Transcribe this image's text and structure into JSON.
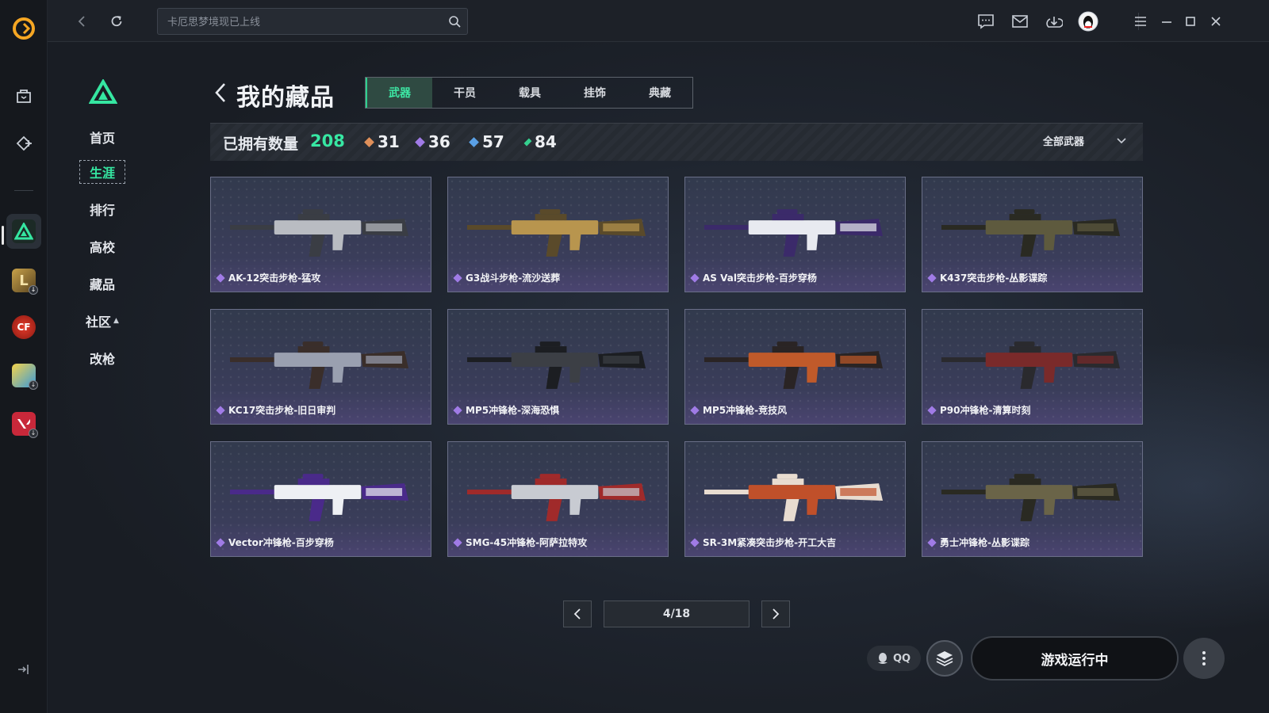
{
  "topbar": {
    "search_placeholder": "卡厄思梦境现已上线"
  },
  "side_nav": {
    "items": [
      {
        "label": "首页"
      },
      {
        "label": "生涯"
      },
      {
        "label": "排行"
      },
      {
        "label": "高校"
      },
      {
        "label": "藏品"
      },
      {
        "label": "社区"
      },
      {
        "label": "改枪"
      }
    ],
    "active_index": 1
  },
  "header": {
    "title": "我的藏品",
    "tabs": [
      "武器",
      "干员",
      "载具",
      "挂饰",
      "典藏"
    ],
    "active_tab": 0
  },
  "stats": {
    "owned_label": "已拥有数量",
    "owned_total": "208",
    "counts": [
      {
        "value": "31",
        "color": "#e0905a"
      },
      {
        "value": "36",
        "color": "#a07be6"
      },
      {
        "value": "57",
        "color": "#5aa0e6"
      },
      {
        "value": "84",
        "color": "#35d08f"
      }
    ],
    "filter_label": "全部武器"
  },
  "items": [
    {
      "name": "AK-12突击步枪-猛攻",
      "rarity_color": "#a07be6",
      "palette": [
        "#b9bcc2",
        "#3a3d44"
      ]
    },
    {
      "name": "G3战斗步枪-流沙送葬",
      "rarity_color": "#a07be6",
      "palette": [
        "#b8954e",
        "#5a4a2a"
      ]
    },
    {
      "name": "AS Val突击步枪-百步穿杨",
      "rarity_color": "#a07be6",
      "palette": [
        "#e8eaf0",
        "#3b2a6a"
      ]
    },
    {
      "name": "K437突击步枪-丛影谍踪",
      "rarity_color": "#a07be6",
      "palette": [
        "#5e5a3e",
        "#2a2a22"
      ]
    },
    {
      "name": "KC17突击步枪-旧日审判",
      "rarity_color": "#a07be6",
      "palette": [
        "#9aa0b0",
        "#3a2e2a"
      ]
    },
    {
      "name": "MP5冲锋枪-深海恐惧",
      "rarity_color": "#a07be6",
      "palette": [
        "#3c3f45",
        "#1c1e22"
      ]
    },
    {
      "name": "MP5冲锋枪-竞技风",
      "rarity_color": "#a07be6",
      "palette": [
        "#c05a2a",
        "#2a2424"
      ]
    },
    {
      "name": "P90冲锋枪-清算时刻",
      "rarity_color": "#a07be6",
      "palette": [
        "#7a2a2a",
        "#2a2a2e"
      ]
    },
    {
      "name": "Vector冲锋枪-百步穿杨",
      "rarity_color": "#a07be6",
      "palette": [
        "#eef0f4",
        "#4a2a8a"
      ]
    },
    {
      "name": "SMG-45冲锋枪-阿萨拉特攻",
      "rarity_color": "#a07be6",
      "palette": [
        "#c8cbd2",
        "#a02a2a"
      ]
    },
    {
      "name": "SR-3M紧凑突击步枪-开工大吉",
      "rarity_color": "#a07be6",
      "palette": [
        "#c0502a",
        "#e8dcd0"
      ]
    },
    {
      "name": "勇士冲锋枪-丛影谍踪",
      "rarity_color": "#a07be6",
      "palette": [
        "#6a6448",
        "#2a2a22"
      ]
    }
  ],
  "pagination": {
    "current": 4,
    "total": 18,
    "label": "4/18"
  },
  "bottom": {
    "qq_label": "QQ",
    "run_label": "游戏运行中"
  },
  "colors": {
    "accent": "#35e6a1",
    "card_border": "#6a6f88"
  }
}
